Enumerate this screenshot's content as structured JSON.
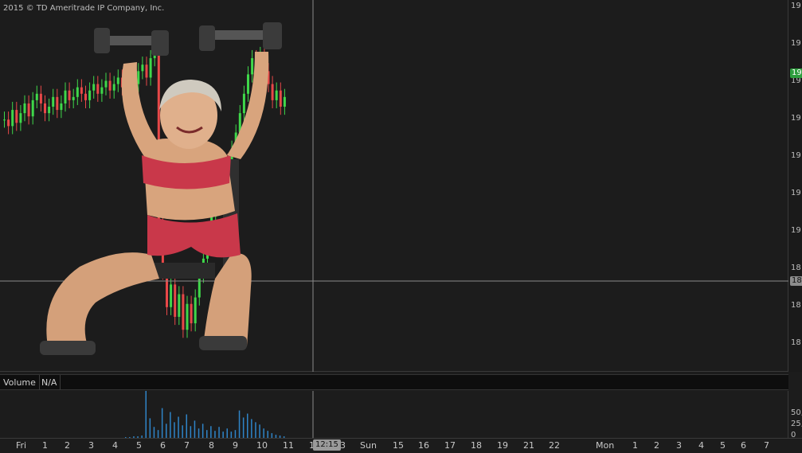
{
  "copyright": "2015 © TD Ameritrade IP Company, Inc.",
  "price_axis": {
    "ticks": [
      "19",
      "19",
      "19",
      "19",
      "19",
      "19",
      "19",
      "18",
      "18",
      "18"
    ],
    "last_price_tag": "19",
    "last_price_color": "#2e9e3e",
    "cursor_price_tag": "18",
    "cursor_price_color": "#8c8c8c"
  },
  "volume_header": {
    "study_label": "Volume",
    "value": "N/A"
  },
  "volume_axis": {
    "ticks": [
      "50,",
      "25,",
      "0"
    ]
  },
  "time_axis": {
    "labels": [
      "Fri",
      "1",
      "2",
      "3",
      "4",
      "5",
      "6",
      "7",
      "8",
      "9",
      "10",
      "11",
      "1",
      "3",
      "Sun",
      "15",
      "16",
      "17",
      "18",
      "19",
      "21",
      "22",
      "Mon",
      "1",
      "2",
      "3",
      "4",
      "5",
      "6",
      "7"
    ],
    "cursor_time": "12:15"
  },
  "overlay_image": {
    "description_icon": "woman-lifting-dumbbells-image"
  },
  "colors": {
    "up_candle": "#3fd84a",
    "down_candle": "#e84848",
    "volume_bar": "#2f84c7",
    "crosshair": "#8a8a8a"
  },
  "chart_data": {
    "type": "candlestick",
    "series": [
      {
        "name": "",
        "close": [
          192.3,
          192.1,
          192.6,
          192.2,
          192.5,
          192.8,
          192.4,
          192.9,
          193.1,
          192.8,
          192.5,
          192.7,
          193.0,
          192.6,
          192.8,
          193.2,
          192.9,
          193.0,
          193.3,
          193.1,
          192.9,
          193.2,
          193.4,
          193.1,
          193.3,
          193.5,
          193.2,
          193.4,
          193.6,
          193.3,
          193.5,
          193.7,
          193.4,
          193.8,
          194.0,
          193.6,
          194.2,
          194.6,
          189.0,
          187.6,
          186.5,
          187.2,
          186.2,
          186.9,
          185.8,
          186.6,
          186.0,
          186.8,
          187.5,
          188.0,
          188.6,
          189.3,
          189.9,
          190.5,
          191.0,
          190.6,
          191.4,
          191.9,
          192.5,
          193.1,
          193.7,
          194.2,
          193.9,
          194.3,
          193.8,
          193.4,
          192.9,
          193.2,
          192.7,
          193.0
        ]
      }
    ],
    "volume": [
      0,
      0,
      0,
      0,
      0,
      0,
      0,
      0,
      0,
      0,
      0,
      0,
      0,
      0,
      0,
      0,
      0,
      0,
      0,
      0,
      0,
      0,
      0,
      0,
      0,
      0,
      0,
      0,
      0,
      0,
      1,
      1,
      2,
      2,
      3,
      60,
      25,
      14,
      10,
      38,
      18,
      33,
      20,
      27,
      16,
      30,
      15,
      22,
      12,
      18,
      10,
      15,
      9,
      14,
      8,
      12,
      8,
      10,
      35,
      26,
      31,
      24,
      20,
      17,
      12,
      9,
      6,
      4,
      3,
      2
    ],
    "volume_ylim": [
      0,
      60
    ]
  }
}
